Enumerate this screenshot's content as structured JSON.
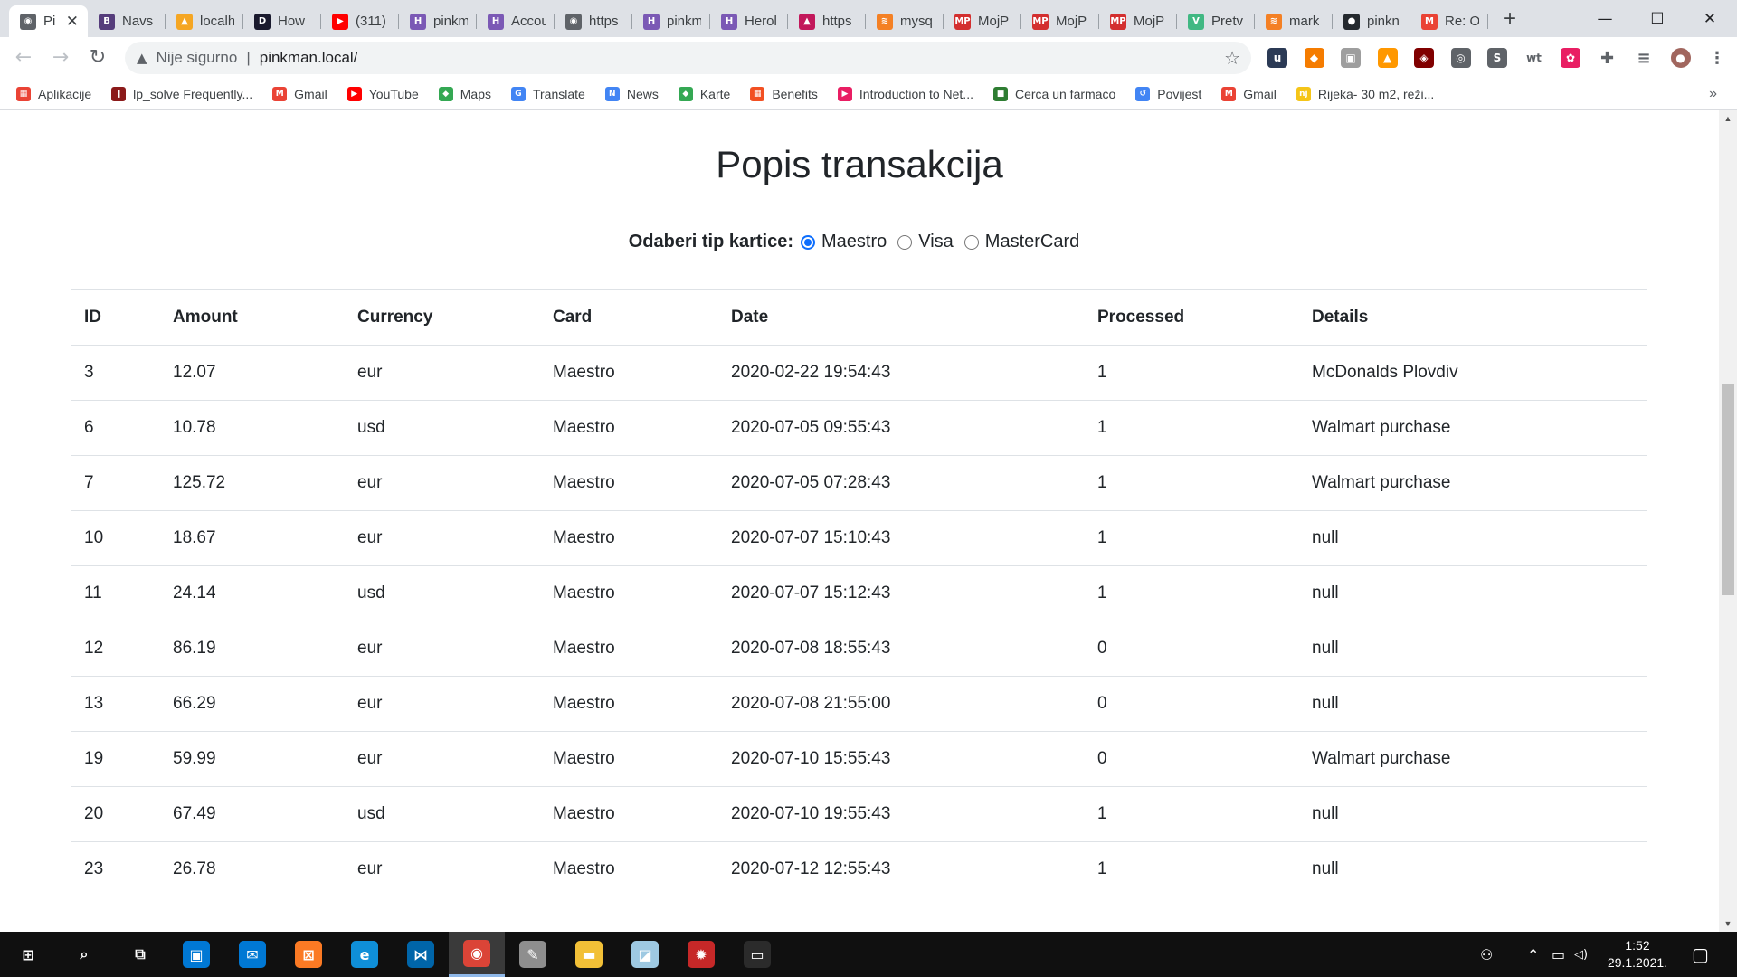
{
  "browser": {
    "tabs": [
      {
        "label": "Pi",
        "icon": "globe-icon",
        "color": "#5f6368",
        "glyph": "◉",
        "active": true
      },
      {
        "label": "Navs",
        "icon": "bootstrap-icon",
        "color": "#563d7c",
        "glyph": "B"
      },
      {
        "label": "localh",
        "icon": "phpmyadmin-icon",
        "color": "#f5a623",
        "glyph": "▲"
      },
      {
        "label": "How",
        "icon": "devdocs-icon",
        "color": "#1a1a2e",
        "glyph": "D"
      },
      {
        "label": "(311)",
        "icon": "youtube-icon",
        "color": "#ff0000",
        "glyph": "▶"
      },
      {
        "label": "pinkm",
        "icon": "heroku-icon",
        "color": "#7b59b5",
        "glyph": "H"
      },
      {
        "label": "Accou",
        "icon": "heroku-icon",
        "color": "#7b59b5",
        "glyph": "H"
      },
      {
        "label": "https",
        "icon": "globe-icon",
        "color": "#5f6368",
        "glyph": "◉"
      },
      {
        "label": "pinkm",
        "icon": "heroku-icon",
        "color": "#7b59b5",
        "glyph": "H"
      },
      {
        "label": "Herol",
        "icon": "heroku-icon",
        "color": "#7b59b5",
        "glyph": "H"
      },
      {
        "label": "https",
        "icon": "vercel-icon",
        "color": "#c2185b",
        "glyph": "▲"
      },
      {
        "label": "mysq",
        "icon": "stackoverflow-icon",
        "color": "#f48024",
        "glyph": "≋"
      },
      {
        "label": "MojP",
        "icon": "mojposao-icon",
        "color": "#d32f2f",
        "glyph": "MP"
      },
      {
        "label": "MojP",
        "icon": "mojposao-icon",
        "color": "#d32f2f",
        "glyph": "MP"
      },
      {
        "label": "MojP",
        "icon": "mojposao-icon",
        "color": "#d32f2f",
        "glyph": "MP"
      },
      {
        "label": "Pretv",
        "icon": "vue-icon",
        "color": "#41b883",
        "glyph": "V"
      },
      {
        "label": "mark",
        "icon": "stackoverflow-icon",
        "color": "#f48024",
        "glyph": "≋"
      },
      {
        "label": "pinkn",
        "icon": "github-icon",
        "color": "#24292e",
        "glyph": "●"
      },
      {
        "label": "Re: O",
        "icon": "gmail-icon",
        "color": "#ea4335",
        "glyph": "M"
      }
    ],
    "tab_close": "✕",
    "new_tab": "+",
    "window_controls": {
      "minimize": "—",
      "maximize": "☐",
      "close": "✕"
    },
    "nav": {
      "back": "←",
      "forward": "→",
      "reload": "↻"
    },
    "omnibox": {
      "warning": "▲",
      "security_text": "Nije sigurno",
      "separator": "|",
      "url": "pinkman.local/",
      "bookmark_star": "☆"
    },
    "extensions": [
      {
        "name": "ext-1-icon",
        "color": "#2b3a55",
        "glyph": "u"
      },
      {
        "name": "ext-2-icon",
        "color": "#f57c00",
        "glyph": "◆"
      },
      {
        "name": "ext-3-icon",
        "color": "#9e9e9e",
        "glyph": "▣"
      },
      {
        "name": "ext-4-icon",
        "color": "#ff9800",
        "glyph": "▲"
      },
      {
        "name": "ublock-icon",
        "color": "#800000",
        "glyph": "◈"
      },
      {
        "name": "ext-6-icon",
        "color": "#5f6368",
        "glyph": "◎"
      },
      {
        "name": "ext-7-icon",
        "color": "#5f6368",
        "glyph": "S"
      },
      {
        "name": "ext-wt-icon",
        "color": "#ffffff",
        "glyph": "wt"
      },
      {
        "name": "colorpicker-icon",
        "color": "#e91e63",
        "glyph": "✿"
      },
      {
        "name": "extensions-puzzle-icon",
        "color": "#ffffff",
        "glyph": "✚"
      },
      {
        "name": "reading-list-icon",
        "color": "#ffffff",
        "glyph": "≡"
      },
      {
        "name": "profile-avatar-icon",
        "color": "#a1665e",
        "glyph": "●"
      },
      {
        "name": "menu-kebab-icon",
        "color": "#ffffff",
        "glyph": "⋮"
      }
    ],
    "bookmarks": [
      {
        "label": "Aplikacije",
        "icon": "apps-grid-icon",
        "color": "#ea4335",
        "glyph": "▦"
      },
      {
        "label": "lp_solve Frequently...",
        "icon": "lpsolve-icon",
        "color": "#8b1a1a",
        "glyph": "‖"
      },
      {
        "label": "Gmail",
        "icon": "gmail-icon",
        "color": "#ea4335",
        "glyph": "M"
      },
      {
        "label": "YouTube",
        "icon": "youtube-icon",
        "color": "#ff0000",
        "glyph": "▶"
      },
      {
        "label": "Maps",
        "icon": "maps-pin-icon",
        "color": "#34a853",
        "glyph": "◆"
      },
      {
        "label": "Translate",
        "icon": "translate-icon",
        "color": "#4285f4",
        "glyph": "G"
      },
      {
        "label": "News",
        "icon": "news-icon",
        "color": "#4285f4",
        "glyph": "N"
      },
      {
        "label": "Karte",
        "icon": "maps-pin-icon",
        "color": "#34a853",
        "glyph": "◆"
      },
      {
        "label": "Benefits",
        "icon": "microsoft-icon",
        "color": "#f25022",
        "glyph": "▦"
      },
      {
        "label": "Introduction to Net...",
        "icon": "net-course-icon",
        "color": "#e91e63",
        "glyph": "▶"
      },
      {
        "label": "Cerca un farmaco",
        "icon": "farmaco-icon",
        "color": "#2e7d32",
        "glyph": "■"
      },
      {
        "label": "Povijest",
        "icon": "history-icon",
        "color": "#4285f4",
        "glyph": "↺"
      },
      {
        "label": "Gmail",
        "icon": "gmail-icon",
        "color": "#ea4335",
        "glyph": "M"
      },
      {
        "label": "Rijeka- 30 m2, reži...",
        "icon": "njuskalo-icon",
        "color": "#f5c518",
        "glyph": "nj"
      }
    ],
    "bookmarks_more": "»"
  },
  "page": {
    "title": "Popis transakcija",
    "filter_label": "Odaberi tip kartice:",
    "card_options": [
      {
        "label": "Maestro",
        "checked": true
      },
      {
        "label": "Visa",
        "checked": false
      },
      {
        "label": "MasterCard",
        "checked": false
      }
    ],
    "table": {
      "columns": [
        "ID",
        "Amount",
        "Currency",
        "Card",
        "Date",
        "Processed",
        "Details"
      ],
      "rows": [
        [
          "3",
          "12.07",
          "eur",
          "Maestro",
          "2020-02-22 19:54:43",
          "1",
          "McDonalds Plovdiv"
        ],
        [
          "6",
          "10.78",
          "usd",
          "Maestro",
          "2020-07-05 09:55:43",
          "1",
          "Walmart purchase"
        ],
        [
          "7",
          "125.72",
          "eur",
          "Maestro",
          "2020-07-05 07:28:43",
          "1",
          "Walmart purchase"
        ],
        [
          "10",
          "18.67",
          "eur",
          "Maestro",
          "2020-07-07 15:10:43",
          "1",
          "null"
        ],
        [
          "11",
          "24.14",
          "usd",
          "Maestro",
          "2020-07-07 15:12:43",
          "1",
          "null"
        ],
        [
          "12",
          "86.19",
          "eur",
          "Maestro",
          "2020-07-08 18:55:43",
          "0",
          "null"
        ],
        [
          "13",
          "66.29",
          "eur",
          "Maestro",
          "2020-07-08 21:55:00",
          "0",
          "null"
        ],
        [
          "19",
          "59.99",
          "eur",
          "Maestro",
          "2020-07-10 15:55:43",
          "0",
          "Walmart purchase"
        ],
        [
          "20",
          "67.49",
          "usd",
          "Maestro",
          "2020-07-10 19:55:43",
          "1",
          "null"
        ],
        [
          "23",
          "26.78",
          "eur",
          "Maestro",
          "2020-07-12 12:55:43",
          "1",
          "null"
        ]
      ]
    }
  },
  "taskbar": {
    "apps": [
      {
        "name": "start-icon",
        "glyph": "⊞",
        "color": "#101010"
      },
      {
        "name": "search-icon",
        "glyph": "⌕",
        "color": "#101010"
      },
      {
        "name": "task-view-icon",
        "glyph": "⧉",
        "color": "#101010"
      },
      {
        "name": "store-icon",
        "glyph": "▣",
        "color": "#0078d4"
      },
      {
        "name": "mail-icon",
        "glyph": "✉",
        "color": "#0078d4"
      },
      {
        "name": "xampp-icon",
        "glyph": "⊠",
        "color": "#fb7a24"
      },
      {
        "name": "edge-icon",
        "glyph": "e",
        "color": "#0f8fd8"
      },
      {
        "name": "vscode-icon",
        "glyph": "⋈",
        "color": "#0065a9"
      },
      {
        "name": "chrome-icon",
        "glyph": "◉",
        "color": "#db4437",
        "active": true
      },
      {
        "name": "paint-icon",
        "glyph": "✎",
        "color": "#8e8e8e"
      },
      {
        "name": "file-explorer-icon",
        "glyph": "▬",
        "color": "#f2c037"
      },
      {
        "name": "notepad-icon",
        "glyph": "◪",
        "color": "#9ec9e2"
      },
      {
        "name": "network-icon",
        "glyph": "✹",
        "color": "#c62828"
      },
      {
        "name": "terminal-icon",
        "glyph": "▭",
        "color": "#2b2b2b"
      }
    ],
    "tray": {
      "people": "⚇",
      "chevron": "⌃",
      "battery": "▭",
      "volume": "◁)",
      "notifications": "▢"
    },
    "clock": {
      "time": "1:52",
      "date": "29.1.2021."
    }
  }
}
